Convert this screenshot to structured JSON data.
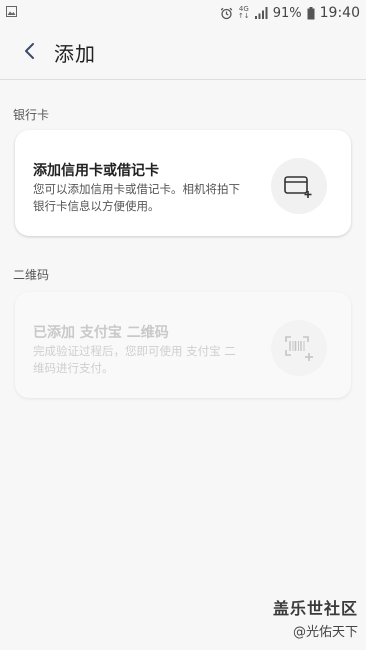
{
  "status_bar": {
    "network_top": "4G",
    "network_bottom": "↑↓",
    "battery": "91%",
    "time": "19:40",
    "icons": [
      "gallery-icon",
      "alarm-icon",
      "signal-icon",
      "battery-icon"
    ]
  },
  "header": {
    "title": "添加",
    "back_icon": "chevron-left-icon"
  },
  "sections": [
    {
      "label": "银行卡",
      "card": {
        "title": "添加信用卡或借记卡",
        "description": "您可以添加信用卡或借记卡。相机将拍下银行卡信息以方便使用。",
        "icon": "card-add-icon",
        "enabled": true
      }
    },
    {
      "label": "二维码",
      "card": {
        "title": "已添加 支付宝 二维码",
        "description": "完成验证过程后，您即可使用 支付宝 二维码进行支付。",
        "icon": "qr-add-icon",
        "enabled": false
      }
    }
  ],
  "watermark": {
    "title": "盖乐世社区",
    "subtitle": "@光佑天下"
  },
  "colors": {
    "background": "#f7f7f7",
    "card": "#ffffff",
    "text_primary": "#222222",
    "text_disabled": "#c9c9c9"
  }
}
